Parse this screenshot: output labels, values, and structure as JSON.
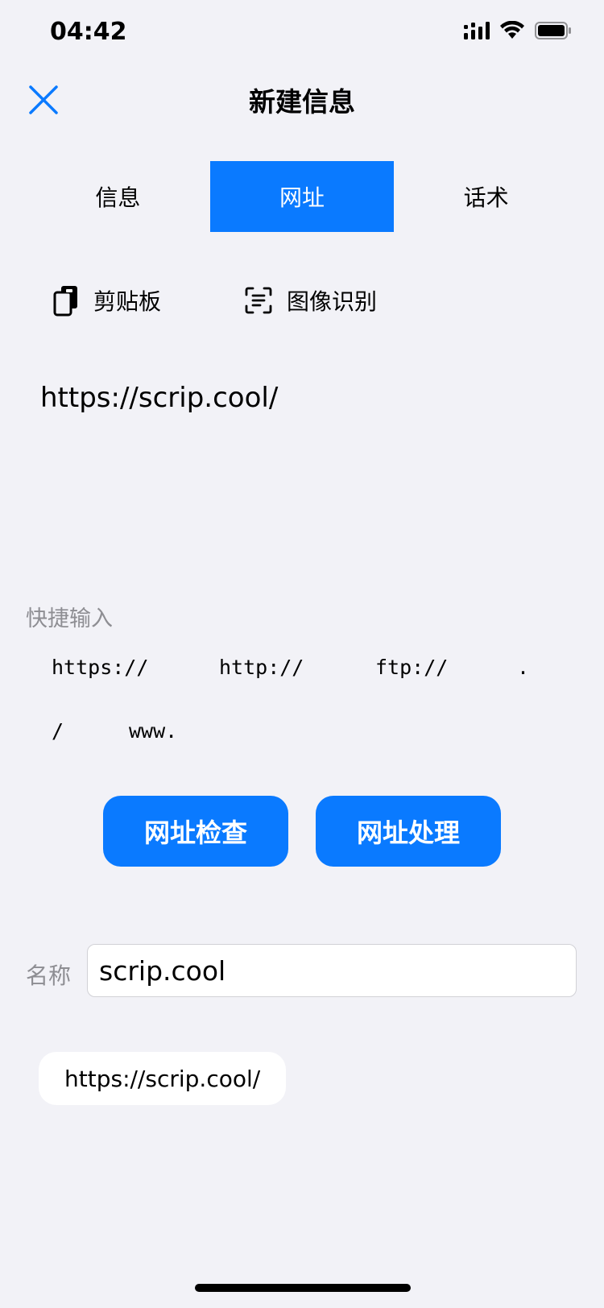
{
  "status_bar": {
    "time": "04:42"
  },
  "header": {
    "title": "新建信息"
  },
  "tabs": [
    {
      "label": "信息",
      "active": false
    },
    {
      "label": "网址",
      "active": true
    },
    {
      "label": "话术",
      "active": false
    }
  ],
  "tools": {
    "clipboard_label": "剪贴板",
    "ocr_label": "图像识别"
  },
  "url_input": {
    "value": "https://scrip.cool/"
  },
  "quick_input": {
    "label": "快捷输入",
    "chips": [
      "https://",
      "http://",
      "ftp://",
      ".",
      "/",
      "www."
    ]
  },
  "actions": {
    "check_label": "网址检查",
    "process_label": "网址处理"
  },
  "name_row": {
    "label": "名称",
    "value": "scrip.cool"
  },
  "result_chip": {
    "label": "https://scrip.cool/"
  },
  "colors": {
    "accent": "#0a7aff",
    "background": "#f2f2f7",
    "secondary_text": "#8e8e93"
  }
}
